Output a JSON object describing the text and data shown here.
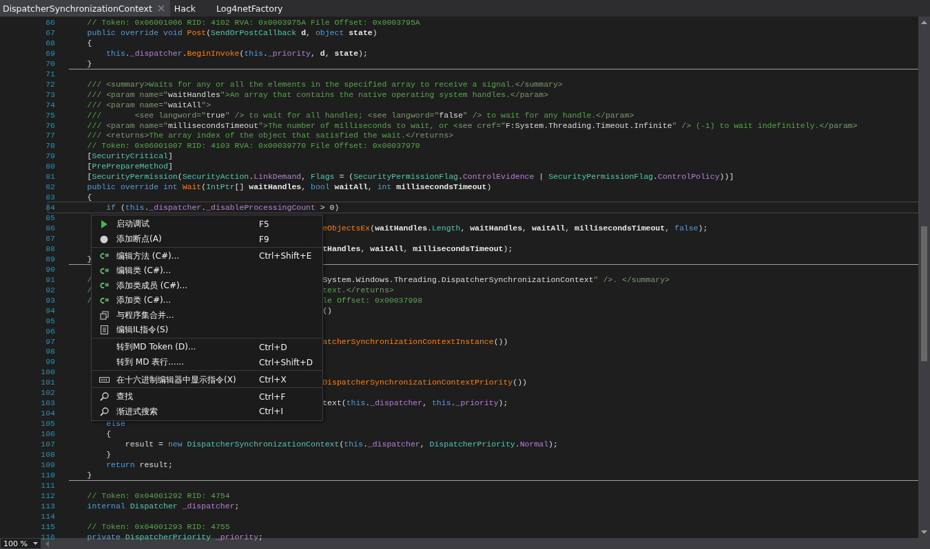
{
  "tabs": [
    {
      "label": "DispatcherSynchronizationContext",
      "selected": true,
      "closable": true
    },
    {
      "label": "Hack",
      "selected": false,
      "closable": false
    },
    {
      "label": "Log4netFactory",
      "selected": false,
      "closable": false
    }
  ],
  "editor": {
    "lines": [
      {
        "n": "66",
        "code": [
          {
            "kind": "comment",
            "text": "    // Token: 0x06001006 RID: 4102 RVA: 0x0003975A File Offset: 0x0003795A"
          }
        ]
      },
      {
        "n": "67",
        "code": [
          {
            "kind": "keyword",
            "text": "    public override void "
          },
          {
            "kind": "method",
            "text": "Post"
          },
          {
            "kind": "plain",
            "text": "("
          },
          {
            "kind": "type",
            "text": "SendOrPostCallback "
          },
          {
            "kind": "param",
            "text": "d"
          },
          {
            "kind": "plain",
            "text": ", "
          },
          {
            "kind": "keyword",
            "text": "object "
          },
          {
            "kind": "param",
            "text": "state"
          },
          {
            "kind": "plain",
            "text": ")"
          }
        ]
      },
      {
        "n": "68",
        "code": [
          {
            "kind": "plain",
            "text": "    {"
          }
        ]
      },
      {
        "n": "69",
        "code": [
          {
            "kind": "keyword",
            "text": "        this"
          },
          {
            "kind": "plain",
            "text": "."
          },
          {
            "kind": "member",
            "text": "_dispatcher"
          },
          {
            "kind": "plain",
            "text": "."
          },
          {
            "kind": "method",
            "text": "BeginInvoke"
          },
          {
            "kind": "plain",
            "text": "("
          },
          {
            "kind": "keyword",
            "text": "this"
          },
          {
            "kind": "plain",
            "text": "."
          },
          {
            "kind": "member",
            "text": "_priority"
          },
          {
            "kind": "plain",
            "text": ", "
          },
          {
            "kind": "param",
            "text": "d"
          },
          {
            "kind": "plain",
            "text": ", "
          },
          {
            "kind": "param",
            "text": "state"
          },
          {
            "kind": "plain",
            "text": ");"
          }
        ]
      },
      {
        "n": "70",
        "code": [
          {
            "kind": "plain",
            "text": "    }"
          }
        ],
        "separator": true
      },
      {
        "n": "71"
      },
      {
        "n": "72",
        "code": [
          {
            "kind": "comment",
            "text": "    /// "
          },
          {
            "kind": "doc-tag",
            "text": "<summary>"
          },
          {
            "kind": "comment",
            "text": "Waits for any or all the elements in the specified array to receive a signal."
          },
          {
            "kind": "doc-tag",
            "text": "</summary>"
          }
        ]
      },
      {
        "n": "73",
        "code": [
          {
            "kind": "comment",
            "text": "    /// "
          },
          {
            "kind": "doc-tag",
            "text": "<param name=\""
          },
          {
            "kind": "doc-value",
            "text": "waitHandles"
          },
          {
            "kind": "doc-tag",
            "text": "\">"
          },
          {
            "kind": "comment",
            "text": "An array that contains the native operating system handles."
          },
          {
            "kind": "doc-tag",
            "text": "</param>"
          }
        ]
      },
      {
        "n": "74",
        "code": [
          {
            "kind": "comment",
            "text": "    /// "
          },
          {
            "kind": "doc-tag",
            "text": "<param name=\""
          },
          {
            "kind": "doc-value",
            "text": "waitAll"
          },
          {
            "kind": "doc-tag",
            "text": "\">"
          }
        ]
      },
      {
        "n": "75",
        "code": [
          {
            "kind": "comment",
            "text": "    ///       "
          },
          {
            "kind": "doc-tag",
            "text": "<see langword=\""
          },
          {
            "kind": "doc-value",
            "text": "true"
          },
          {
            "kind": "doc-tag",
            "text": "\" />"
          },
          {
            "kind": "comment",
            "text": " to wait for all handles; "
          },
          {
            "kind": "doc-tag",
            "text": "<see langword=\""
          },
          {
            "kind": "doc-value",
            "text": "false"
          },
          {
            "kind": "doc-tag",
            "text": "\" />"
          },
          {
            "kind": "comment",
            "text": " to wait for any handle."
          },
          {
            "kind": "doc-tag",
            "text": "</param>"
          }
        ]
      },
      {
        "n": "76",
        "code": [
          {
            "kind": "comment",
            "text": "    /// "
          },
          {
            "kind": "doc-tag",
            "text": "<param name=\""
          },
          {
            "kind": "doc-value",
            "text": "millisecondsTimeout"
          },
          {
            "kind": "doc-tag",
            "text": "\">"
          },
          {
            "kind": "comment",
            "text": "The number of milliseconds to wait, or "
          },
          {
            "kind": "doc-tag",
            "text": "<see cref=\""
          },
          {
            "kind": "doc-value",
            "text": "F:System.Threading.Timeout.Infinite"
          },
          {
            "kind": "doc-tag",
            "text": "\" />"
          },
          {
            "kind": "comment",
            "text": " (-1) to wait indefinitely."
          },
          {
            "kind": "doc-tag",
            "text": "</param>"
          }
        ]
      },
      {
        "n": "77",
        "code": [
          {
            "kind": "comment",
            "text": "    /// "
          },
          {
            "kind": "doc-tag",
            "text": "<returns>"
          },
          {
            "kind": "comment",
            "text": "The array index of the object that satisfied the wait."
          },
          {
            "kind": "doc-tag",
            "text": "</returns>"
          }
        ]
      },
      {
        "n": "78",
        "code": [
          {
            "kind": "comment",
            "text": "    // Token: 0x06001007 RID: 4103 RVA: 0x00039770 File Offset: 0x00037970"
          }
        ]
      },
      {
        "n": "79",
        "code": [
          {
            "kind": "plain",
            "text": "    ["
          },
          {
            "kind": "type",
            "text": "SecurityCritical"
          },
          {
            "kind": "plain",
            "text": "]"
          }
        ]
      },
      {
        "n": "80",
        "code": [
          {
            "kind": "plain",
            "text": "    ["
          },
          {
            "kind": "type",
            "text": "PrePrepareMethod"
          },
          {
            "kind": "plain",
            "text": "]"
          }
        ]
      },
      {
        "n": "81",
        "code": [
          {
            "kind": "plain",
            "text": "    ["
          },
          {
            "kind": "type",
            "text": "SecurityPermission"
          },
          {
            "kind": "plain",
            "text": "("
          },
          {
            "kind": "type",
            "text": "SecurityAction"
          },
          {
            "kind": "plain",
            "text": "."
          },
          {
            "kind": "member",
            "text": "LinkDemand"
          },
          {
            "kind": "plain",
            "text": ", "
          },
          {
            "kind": "type",
            "text": "Flags"
          },
          {
            "kind": "plain",
            "text": " = ("
          },
          {
            "kind": "type",
            "text": "SecurityPermissionFlag"
          },
          {
            "kind": "plain",
            "text": "."
          },
          {
            "kind": "member",
            "text": "ControlEvidence"
          },
          {
            "kind": "plain",
            "text": " | "
          },
          {
            "kind": "type",
            "text": "SecurityPermissionFlag"
          },
          {
            "kind": "plain",
            "text": "."
          },
          {
            "kind": "member",
            "text": "ControlPolicy"
          },
          {
            "kind": "plain",
            "text": "))]"
          }
        ]
      },
      {
        "n": "82",
        "code": [
          {
            "kind": "keyword",
            "text": "    public override int "
          },
          {
            "kind": "method",
            "text": "Wait"
          },
          {
            "kind": "plain",
            "text": "("
          },
          {
            "kind": "type",
            "text": "IntPtr"
          },
          {
            "kind": "plain",
            "text": "[] "
          },
          {
            "kind": "param",
            "text": "waitHandles"
          },
          {
            "kind": "plain",
            "text": ", "
          },
          {
            "kind": "keyword",
            "text": "bool "
          },
          {
            "kind": "param",
            "text": "waitAll"
          },
          {
            "kind": "plain",
            "text": ", "
          },
          {
            "kind": "keyword",
            "text": "int "
          },
          {
            "kind": "param",
            "text": "millisecondsTimeout"
          },
          {
            "kind": "plain",
            "text": ")"
          }
        ]
      },
      {
        "n": "83",
        "code": [
          {
            "kind": "plain",
            "text": "    {"
          }
        ]
      },
      {
        "n": "84",
        "code": [
          {
            "kind": "keyword",
            "text": "        if"
          },
          {
            "kind": "plain",
            "text": " ("
          },
          {
            "kind": "keyword",
            "text": "this"
          },
          {
            "kind": "plain",
            "text": "."
          },
          {
            "kind": "member",
            "text": "_dispatcher"
          },
          {
            "kind": "plain",
            "text": "."
          },
          {
            "kind": "member",
            "text": "_disableProcessingCount"
          },
          {
            "kind": "plain",
            "text": " > 0)"
          }
        ],
        "selected": true
      },
      {
        "n": "85"
      },
      {
        "n": "86",
        "after_menu": [
          {
            "kind": "method",
            "text": "eObjectsEx"
          },
          {
            "kind": "plain",
            "text": "("
          },
          {
            "kind": "param",
            "text": "waitHandles"
          },
          {
            "kind": "plain",
            "text": "."
          },
          {
            "kind": "type",
            "text": "Length"
          },
          {
            "kind": "plain",
            "text": ", "
          },
          {
            "kind": "param",
            "text": "waitHandles"
          },
          {
            "kind": "plain",
            "text": ", "
          },
          {
            "kind": "param",
            "text": "waitAll"
          },
          {
            "kind": "plain",
            "text": ", "
          },
          {
            "kind": "param",
            "text": "millisecondsTimeout"
          },
          {
            "kind": "plain",
            "text": ", "
          },
          {
            "kind": "keyword",
            "text": "false"
          },
          {
            "kind": "plain",
            "text": ");"
          }
        ]
      },
      {
        "n": "87"
      },
      {
        "n": "88",
        "after_menu": [
          {
            "kind": "param",
            "text": "tHandles"
          },
          {
            "kind": "plain",
            "text": ", "
          },
          {
            "kind": "param",
            "text": "waitAll"
          },
          {
            "kind": "plain",
            "text": ", "
          },
          {
            "kind": "param",
            "text": "millisecondsTimeout"
          },
          {
            "kind": "plain",
            "text": ");"
          }
        ]
      },
      {
        "n": "89",
        "code": [
          {
            "kind": "plain",
            "text": "    }"
          }
        ],
        "separator": true
      },
      {
        "n": "90"
      },
      {
        "n": "91",
        "code": [
          {
            "kind": "comment",
            "text": "    /"
          }
        ],
        "after_menu": [
          {
            "kind": "doc-value",
            "text": "System.Windows.Threading.DispatcherSynchronizationContext"
          },
          {
            "kind": "doc-tag",
            "text": "\" />. </summary>"
          }
        ]
      },
      {
        "n": "92",
        "code": [
          {
            "kind": "comment",
            "text": "    /"
          }
        ],
        "after_menu": [
          {
            "kind": "comment",
            "text": "text."
          },
          {
            "kind": "doc-tag",
            "text": "</returns>"
          }
        ]
      },
      {
        "n": "93",
        "code": [
          {
            "kind": "comment",
            "text": "    /"
          }
        ],
        "after_menu": [
          {
            "kind": "comment",
            "text": "le Offset: 0x00037998"
          }
        ]
      },
      {
        "n": "94",
        "after_menu": [
          {
            "kind": "plain",
            "text": "()"
          }
        ]
      },
      {
        "n": "95"
      },
      {
        "n": "96"
      },
      {
        "n": "97",
        "after_menu": [
          {
            "kind": "method",
            "text": "atcherSynchronizationContextInstance"
          },
          {
            "kind": "plain",
            "text": "())"
          }
        ]
      },
      {
        "n": "98"
      },
      {
        "n": "99"
      },
      {
        "n": "100"
      },
      {
        "n": "101",
        "after_menu": [
          {
            "kind": "method",
            "text": "DispatcherSynchronizationContextPriority"
          },
          {
            "kind": "plain",
            "text": "())"
          }
        ]
      },
      {
        "n": "102"
      },
      {
        "n": "103",
        "after_menu": [
          {
            "kind": "plain",
            "text": "text("
          },
          {
            "kind": "keyword",
            "text": "this"
          },
          {
            "kind": "plain",
            "text": "."
          },
          {
            "kind": "member",
            "text": "_dispatcher"
          },
          {
            "kind": "plain",
            "text": ", "
          },
          {
            "kind": "keyword",
            "text": "this"
          },
          {
            "kind": "plain",
            "text": "."
          },
          {
            "kind": "member",
            "text": "_priority"
          },
          {
            "kind": "plain",
            "text": ");"
          }
        ]
      },
      {
        "n": "104"
      },
      {
        "n": "105",
        "code": [
          {
            "kind": "keyword",
            "text": "        else"
          }
        ]
      },
      {
        "n": "106",
        "code": [
          {
            "kind": "plain",
            "text": "        {"
          }
        ]
      },
      {
        "n": "107",
        "code": [
          {
            "kind": "plain",
            "text": "            result = "
          },
          {
            "kind": "keyword",
            "text": "new "
          },
          {
            "kind": "type",
            "text": "DispatcherSynchronizationContext"
          },
          {
            "kind": "plain",
            "text": "("
          },
          {
            "kind": "keyword",
            "text": "this"
          },
          {
            "kind": "plain",
            "text": "."
          },
          {
            "kind": "member",
            "text": "_dispatcher"
          },
          {
            "kind": "plain",
            "text": ", "
          },
          {
            "kind": "type",
            "text": "DispatcherPriority"
          },
          {
            "kind": "plain",
            "text": "."
          },
          {
            "kind": "member",
            "text": "Normal"
          },
          {
            "kind": "plain",
            "text": ");"
          }
        ]
      },
      {
        "n": "108",
        "code": [
          {
            "kind": "plain",
            "text": "        }"
          }
        ]
      },
      {
        "n": "109",
        "code": [
          {
            "kind": "keyword",
            "text": "        return"
          },
          {
            "kind": "plain",
            "text": " result;"
          }
        ]
      },
      {
        "n": "110",
        "code": [
          {
            "kind": "plain",
            "text": "    }"
          }
        ],
        "separator": true
      },
      {
        "n": "111"
      },
      {
        "n": "112",
        "code": [
          {
            "kind": "comment",
            "text": "    // Token: 0x04001292 RID: 4754"
          }
        ]
      },
      {
        "n": "113",
        "code": [
          {
            "kind": "keyword",
            "text": "    internal "
          },
          {
            "kind": "type",
            "text": "Dispatcher "
          },
          {
            "kind": "member",
            "text": "_dispatcher"
          },
          {
            "kind": "plain",
            "text": ";"
          }
        ]
      },
      {
        "n": "114"
      },
      {
        "n": "115",
        "code": [
          {
            "kind": "comment",
            "text": "    // Token: 0x04001293 RID: 4755"
          }
        ]
      },
      {
        "n": "116",
        "code": [
          {
            "kind": "keyword",
            "text": "    private "
          },
          {
            "kind": "type",
            "text": "DispatcherPriority "
          },
          {
            "kind": "member",
            "text": "_priority"
          },
          {
            "kind": "plain",
            "text": ";"
          }
        ]
      }
    ]
  },
  "context_menu": [
    {
      "kind": "run",
      "label": "启动调试",
      "shortcut": "F5",
      "separator_after": false
    },
    {
      "kind": "breakpoint",
      "label": "添加断点(A)",
      "shortcut": "F9",
      "separator_after": true
    },
    {
      "kind": "code-edit",
      "label": "编辑方法 (C#)...",
      "shortcut": "Ctrl+Shift+E",
      "separator_after": false
    },
    {
      "kind": "code-edit",
      "label": "编辑类 (C#)...",
      "separator_after": false
    },
    {
      "kind": "code-edit",
      "label": "添加类成员 (C#)...",
      "separator_after": false
    },
    {
      "kind": "code-edit",
      "label": "添加类 (C#)...",
      "separator_after": false
    },
    {
      "kind": "merge",
      "label": "与程序集合并...",
      "separator_after": false
    },
    {
      "kind": "il",
      "label": "编辑IL指令(S)",
      "separator_after": true
    },
    {
      "kind": "plain",
      "label": "转到MD Token (D)...",
      "shortcut": "Ctrl+D",
      "separator_after": false
    },
    {
      "kind": "plain",
      "label": "转到 MD 表行......",
      "shortcut": "Ctrl+Shift+D",
      "separator_after": true
    },
    {
      "kind": "hex",
      "label": "在十六进制编辑器中显示指令(X)",
      "shortcut": "Ctrl+X",
      "separator_after": true
    },
    {
      "kind": "search",
      "label": "查找",
      "shortcut": "Ctrl+F",
      "separator_after": false
    },
    {
      "kind": "search",
      "label": "渐进式搜索",
      "shortcut": "Ctrl+I",
      "separator_after": false
    }
  ],
  "status_bar": {
    "zoom": "100 %"
  }
}
